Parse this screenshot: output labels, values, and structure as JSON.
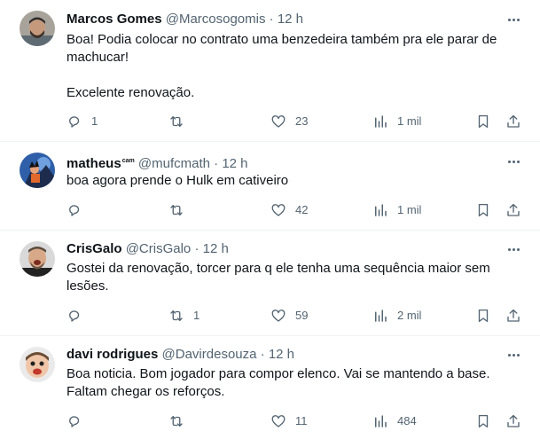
{
  "tweets": [
    {
      "name": "Marcos Gomes",
      "name_badge": "",
      "handle": "@Marcosogomis",
      "separator": "·",
      "time": "12 h",
      "text": "Boa! Podia colocar no contrato uma benzedeira também pra ele parar de machucar!\n\nExcelente renovação.",
      "replies": "1",
      "retweets": "",
      "likes": "23",
      "views": "1 mil"
    },
    {
      "name": "matheus",
      "name_badge": "cam",
      "handle": "@mufcmath",
      "separator": "·",
      "time": "12 h",
      "text": "boa agora prende o Hulk em cativeiro",
      "replies": "",
      "retweets": "",
      "likes": "42",
      "views": "1 mil"
    },
    {
      "name": "CrisGalo",
      "name_badge": "",
      "handle": "@CrisGalo",
      "separator": "·",
      "time": "12 h",
      "text": "Gostei da renovação, torcer para q ele tenha uma sequência maior sem lesões.",
      "replies": "",
      "retweets": "1",
      "likes": "59",
      "views": "2 mil"
    },
    {
      "name": "davi rodrigues",
      "name_badge": "",
      "handle": "@Davirdesouza",
      "separator": "·",
      "time": "12 h",
      "text": "Boa noticia.  Bom jogador para compor elenco.  Vai se mantendo a base.  Faltam chegar os reforços.",
      "replies": "",
      "retweets": "",
      "likes": "11",
      "views": "484"
    }
  ],
  "icons": {
    "reply": "reply-icon",
    "retweet": "retweet-icon",
    "like": "heart-icon",
    "views": "views-icon",
    "bookmark": "bookmark-icon",
    "share": "share-icon",
    "more": "more-options-icon"
  },
  "colors": {
    "text": "#0f1419",
    "secondary": "#536471",
    "divider": "#eff3f4"
  }
}
